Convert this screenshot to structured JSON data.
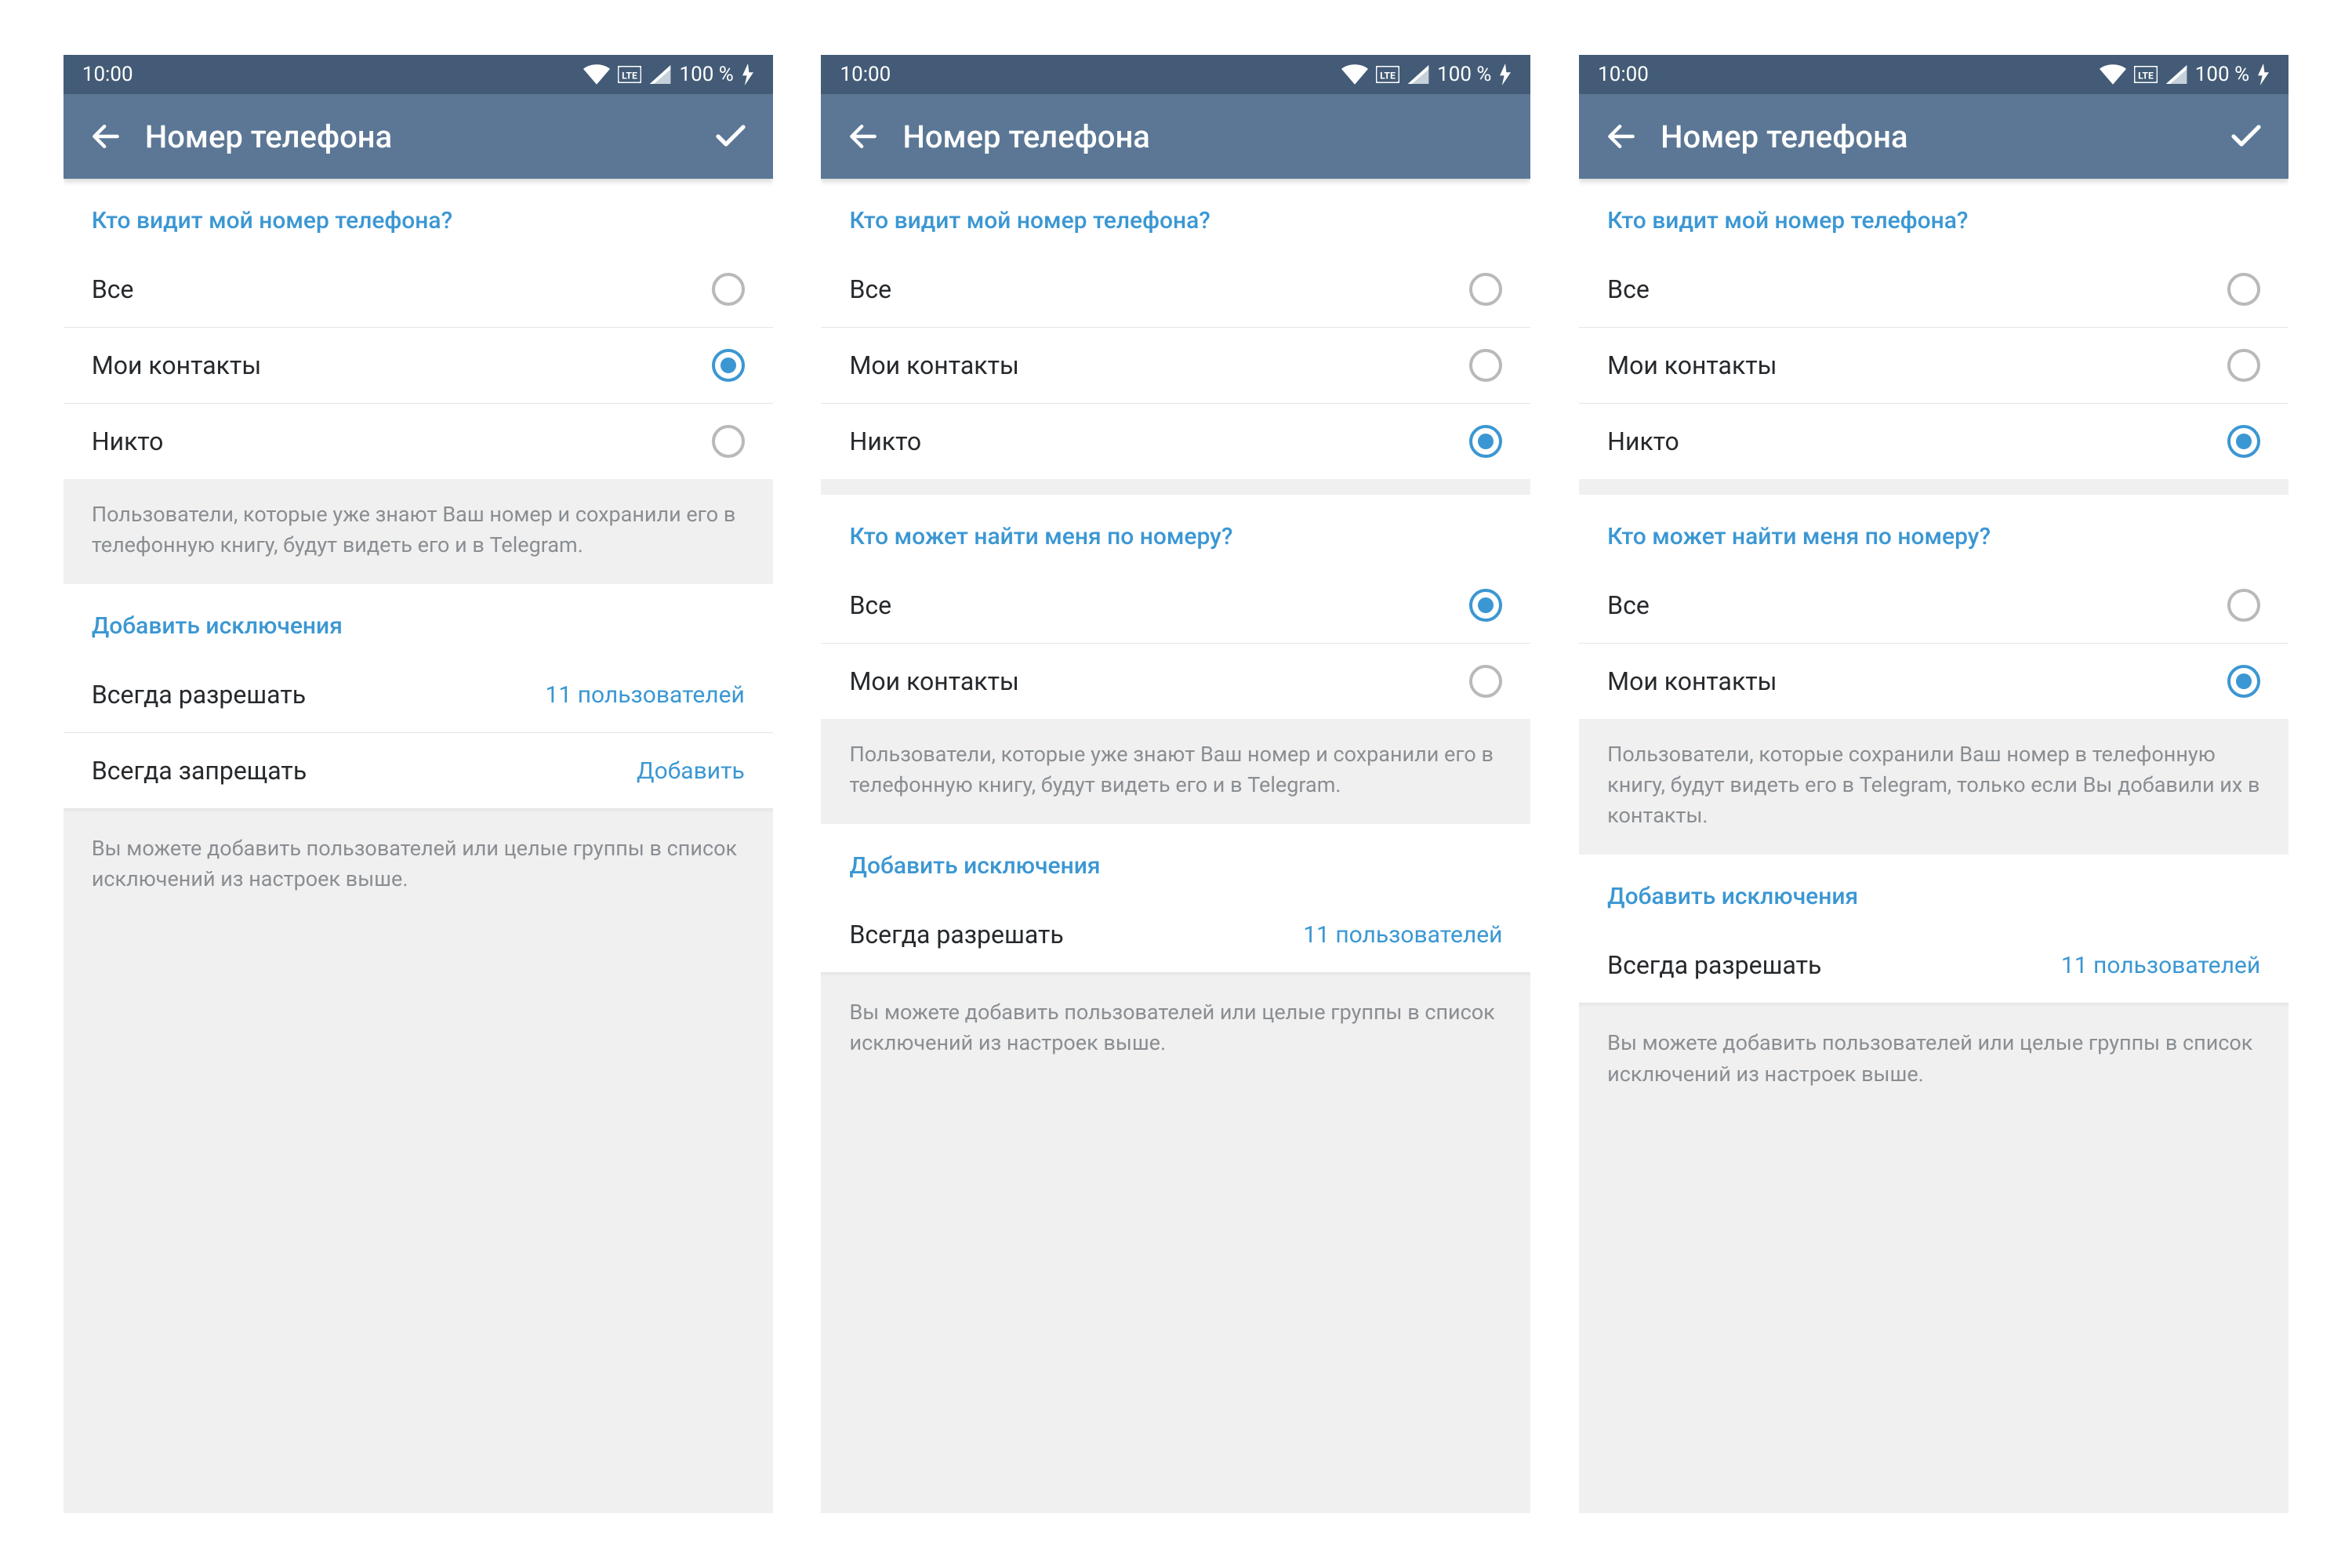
{
  "statusbar": {
    "time": "10:00",
    "battery": "100 %"
  },
  "header": {
    "title": "Номер телефона"
  },
  "sections": {
    "who_sees": "Кто видит мой номер телефона?",
    "who_finds": "Кто может найти меня по номеру?",
    "exceptions": "Добавить исключения"
  },
  "options": {
    "everyone": "Все",
    "contacts": "Мои контакты",
    "nobody": "Никто"
  },
  "exceptions": {
    "allow": "Всегда разрешать",
    "deny": "Всегда запрещать",
    "count": "11 пользователей",
    "add": "Добавить"
  },
  "notes": {
    "contacts_see": "Пользователи, которые уже знают Ваш номер и сохранили его в телефонную книгу, будут видеть его и в Telegram.",
    "only_contacts": "Пользователи, которые сохранили Ваш номер в телефонную книгу, будут видеть его в Telegram, только если Вы добавили их в контакты.",
    "exceptions": "Вы можете добавить пользователей или целые группы в список исключений из настроек выше."
  },
  "screens": [
    {
      "confirm": true,
      "who_sees_selected": "contacts",
      "who_finds": null,
      "note": "contacts_see",
      "exceptions": [
        {
          "label": "allow",
          "value": "count"
        },
        {
          "label": "deny",
          "value": "add"
        }
      ]
    },
    {
      "confirm": false,
      "who_sees_selected": "nobody",
      "who_finds": {
        "selected": "everyone"
      },
      "note": "contacts_see",
      "exceptions": [
        {
          "label": "allow",
          "value": "count"
        }
      ]
    },
    {
      "confirm": true,
      "who_sees_selected": "nobody",
      "who_finds": {
        "selected": "contacts"
      },
      "note": "only_contacts",
      "exceptions": [
        {
          "label": "allow",
          "value": "count"
        }
      ]
    }
  ]
}
